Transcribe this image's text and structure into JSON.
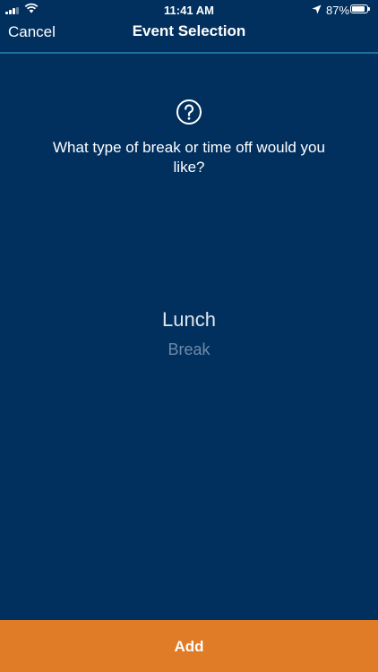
{
  "status_bar": {
    "time": "11:41 AM",
    "battery_percent_label": "87%",
    "battery_level": 0.87
  },
  "nav": {
    "cancel_label": "Cancel",
    "title": "Event Selection"
  },
  "content": {
    "question": "What type of break or time off would you like?",
    "picker_options": [
      "Lunch",
      "Break"
    ],
    "selected_option": "Lunch"
  },
  "footer": {
    "add_label": "Add"
  },
  "colors": {
    "background": "#01305f",
    "accent": "#e07b27",
    "divider": "#1d6f9e"
  },
  "icons": {
    "help": "question-circle-icon",
    "location": "location-arrow-icon"
  }
}
